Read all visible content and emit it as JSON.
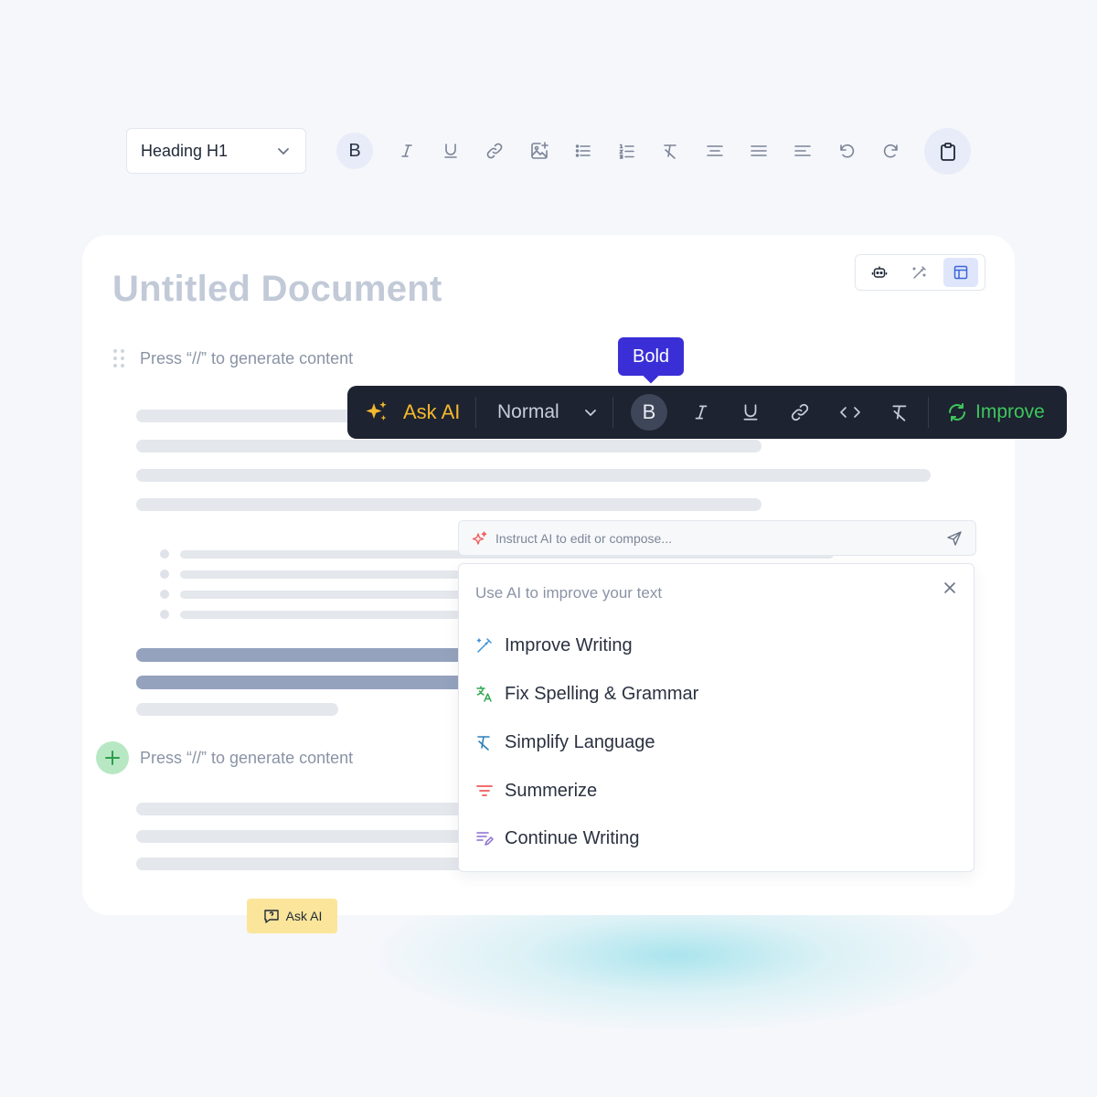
{
  "toolbar": {
    "heading_select": "Heading H1",
    "buttons": [
      "bold",
      "italic",
      "underline",
      "link",
      "image",
      "bullet-list",
      "numbered-list",
      "clear-format",
      "align-center",
      "align-justify",
      "align-left",
      "undo",
      "redo",
      "clipboard"
    ],
    "bold_glyph": "B",
    "active": "bold"
  },
  "document": {
    "title": "Untitled Document",
    "placeholder_1": "Press “//” to generate content",
    "placeholder_2": "Press “//” to generate content",
    "view_toggle": [
      "robot-icon",
      "magic-wand-icon",
      "layout-icon"
    ],
    "view_toggle_active": "layout-icon"
  },
  "float_toolbar": {
    "tooltip": "Bold",
    "ask_ai": "Ask AI",
    "text_style": "Normal",
    "bold_glyph": "B",
    "improve": "Improve",
    "accent_ask": "#f5b82e",
    "accent_improve": "#3ec65d",
    "tooltip_color": "#3a2fd6"
  },
  "ai_input": {
    "placeholder": "Instruct AI to edit or compose..."
  },
  "ai_menu": {
    "heading": "Use AI to improve your text",
    "items": [
      {
        "label": "Improve Writing",
        "icon": "magic-wand-icon"
      },
      {
        "label": "Fix Spelling & Grammar",
        "icon": "translate-icon"
      },
      {
        "label": "Simplify Language",
        "icon": "clear-format-icon"
      },
      {
        "label": "Summerize",
        "icon": "filter-lines-icon"
      },
      {
        "label": "Continue Writing",
        "icon": "pencil-lines-icon"
      }
    ]
  },
  "ask_ai_chip": {
    "label": "Ask AI"
  }
}
